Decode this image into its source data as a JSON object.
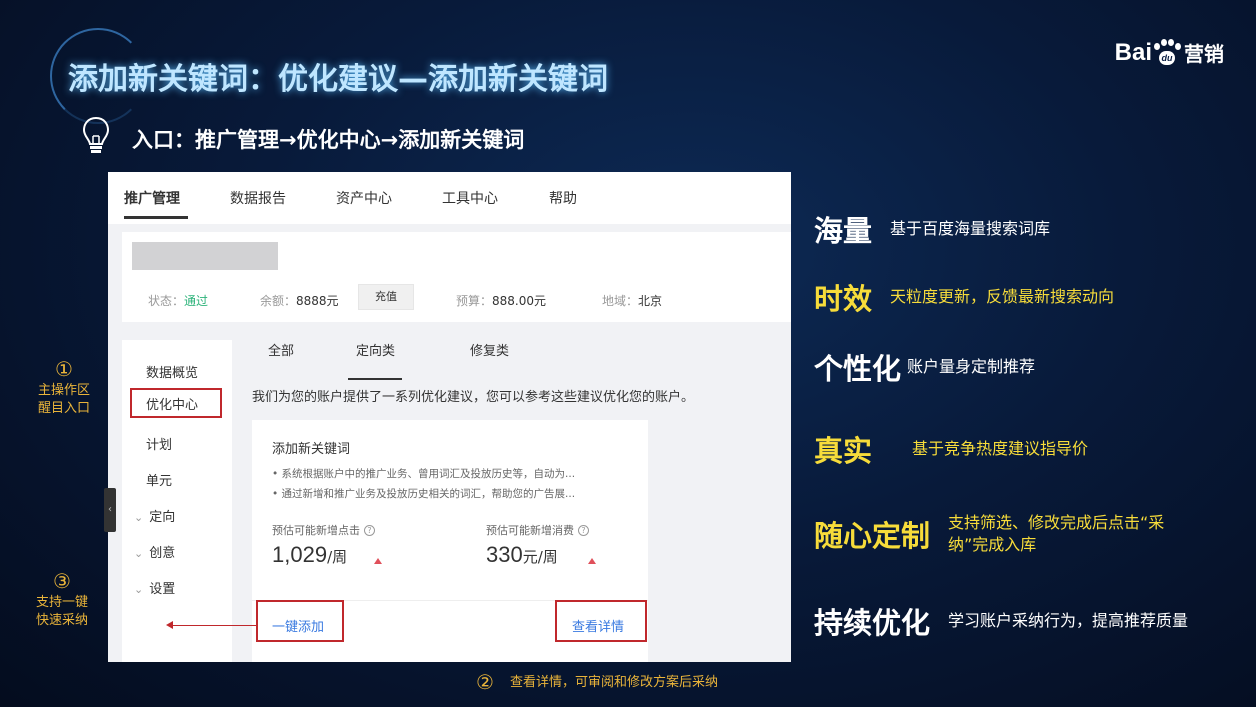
{
  "slide": {
    "title": "添加新关键词：优化建议—添加新关键词",
    "entry": "入口：推广管理→优化中心→添加新关键词",
    "logo": {
      "bai": "Bai",
      "du": "du",
      "suffix": "营销"
    },
    "icons": {
      "bulb": "lightbulb-icon"
    }
  },
  "topnav": [
    "推广管理",
    "数据报告",
    "资产中心",
    "工具中心",
    "帮助"
  ],
  "account": {
    "status_label": "状态：",
    "status_value": "通过",
    "balance_label": "余额：",
    "balance_value": "8888元",
    "recharge": "充值",
    "budget_label": "预算：",
    "budget_value": "888.00元",
    "region_label": "地域：",
    "region_value": "北京"
  },
  "sidebar": [
    "数据概览",
    "优化中心",
    "计划",
    "单元",
    "定向",
    "创意",
    "设置"
  ],
  "tabs": [
    "全部",
    "定向类",
    "修复类"
  ],
  "intro": "我们为您的账户提供了一系列优化建议，您可以参考这些建议优化您的账户。",
  "suggestion": {
    "title": "添加新关键词",
    "bullets": [
      "• 系统根据账户中的推广业务、曾用词汇及投放历史等，自动为...",
      "• 通过新增和推广业务及投放历史相关的词汇，帮助您的广告展..."
    ],
    "metrics": [
      {
        "label": "预估可能新增点击",
        "value": "1,029",
        "unit": "/周"
      },
      {
        "label": "预估可能新增消费",
        "value": "330",
        "unit": "元/周"
      }
    ],
    "add_button": "一键添加",
    "detail_button": "查看详情"
  },
  "annotations": {
    "a1_num": "①",
    "a1_text_1": "主操作区",
    "a1_text_2": "醒目入口",
    "a3_num": "③",
    "a3_text_1": "支持一键",
    "a3_text_2": "快速采纳",
    "a2_num": "②",
    "a2_text": "查看详情，可审阅和修改方案后采纳"
  },
  "features": [
    {
      "key": "海量",
      "desc": "基于百度海量搜索词库",
      "color": "#ffffff"
    },
    {
      "key": "时效",
      "desc": "天粒度更新，反馈最新搜索动向",
      "color": "#f7dc3a"
    },
    {
      "key": "个性化",
      "desc": "账户量身定制推荐",
      "color": "#ffffff"
    },
    {
      "key": "真实",
      "desc": "基于竞争热度建议指导价",
      "color": "#f7dc3a"
    },
    {
      "key": "随心定制",
      "desc_1": "支持筛选、修改完成后点击“采",
      "desc_2": "纳”完成入库",
      "color": "#f7dc3a"
    },
    {
      "key": "持续优化",
      "desc": "学习账户采纳行为，提高推荐质量",
      "color": "#ffffff"
    }
  ]
}
